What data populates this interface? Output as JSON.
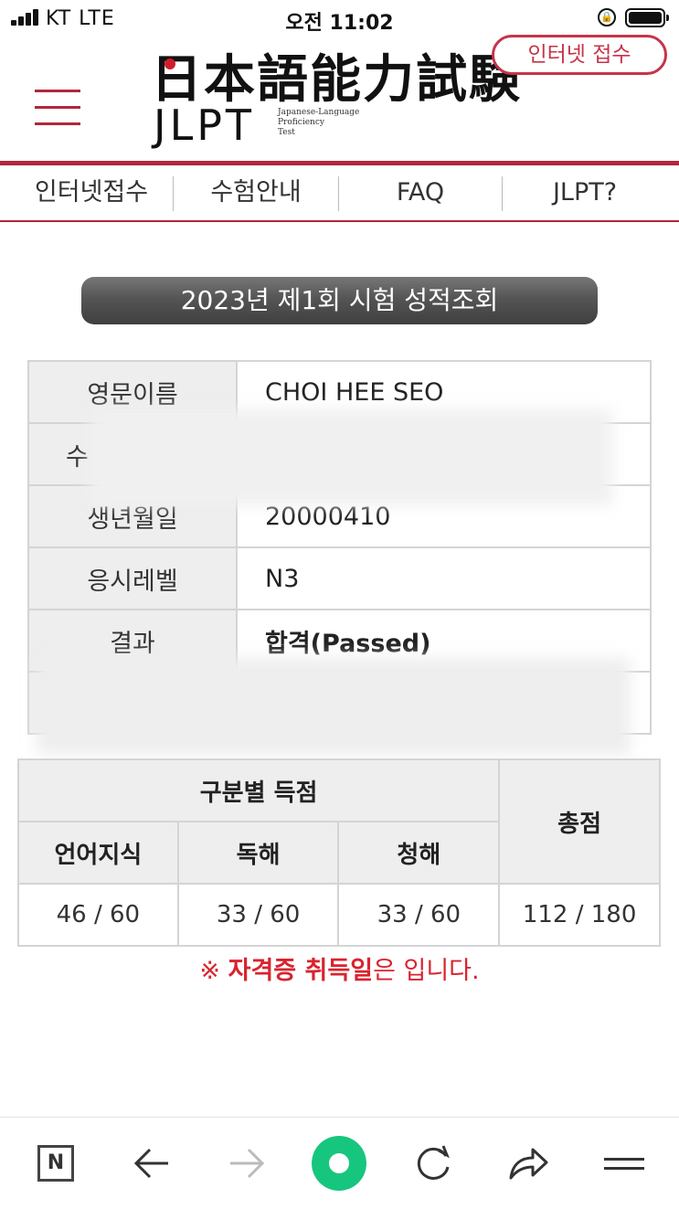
{
  "status_bar": {
    "carrier": "KT   LTE",
    "time": "오전 11:02"
  },
  "header": {
    "logo_kanji": "日本語能力試験",
    "logo_jlpt": "JLPT",
    "logo_sub_line1": "Japanese-Language",
    "logo_sub_line2": "Proficiency",
    "logo_sub_line3": "Test",
    "register_button": "인터넷 접수"
  },
  "nav": {
    "items": [
      {
        "label": "인터넷접수"
      },
      {
        "label": "수험안내"
      },
      {
        "label": "FAQ"
      },
      {
        "label": "JLPT?"
      }
    ]
  },
  "banner": {
    "title": "2023년 제1회   시험 성적조회"
  },
  "info_table": {
    "rows": [
      {
        "key": "영문이름",
        "value": "CHOI HEE SEO"
      },
      {
        "key": "수",
        "value": ""
      },
      {
        "key": "생년월일",
        "value": "20000410"
      },
      {
        "key": "응시레벨",
        "value": "N3"
      },
      {
        "key": "결과",
        "value": "합격(Passed)"
      },
      {
        "key": "",
        "value": ""
      }
    ]
  },
  "score_table": {
    "section_header": "구분별 득점",
    "total_header": "총점",
    "sub_headers": [
      "언어지식",
      "독해",
      "청해"
    ],
    "scores": [
      "46 / 60",
      "33 / 60",
      "33 / 60"
    ],
    "total": "112 / 180"
  },
  "note": {
    "prefix": "※ ",
    "bold": "자격증 취득일",
    "suffix": "은 입니다."
  },
  "toolbar": {
    "n_label": "N"
  }
}
